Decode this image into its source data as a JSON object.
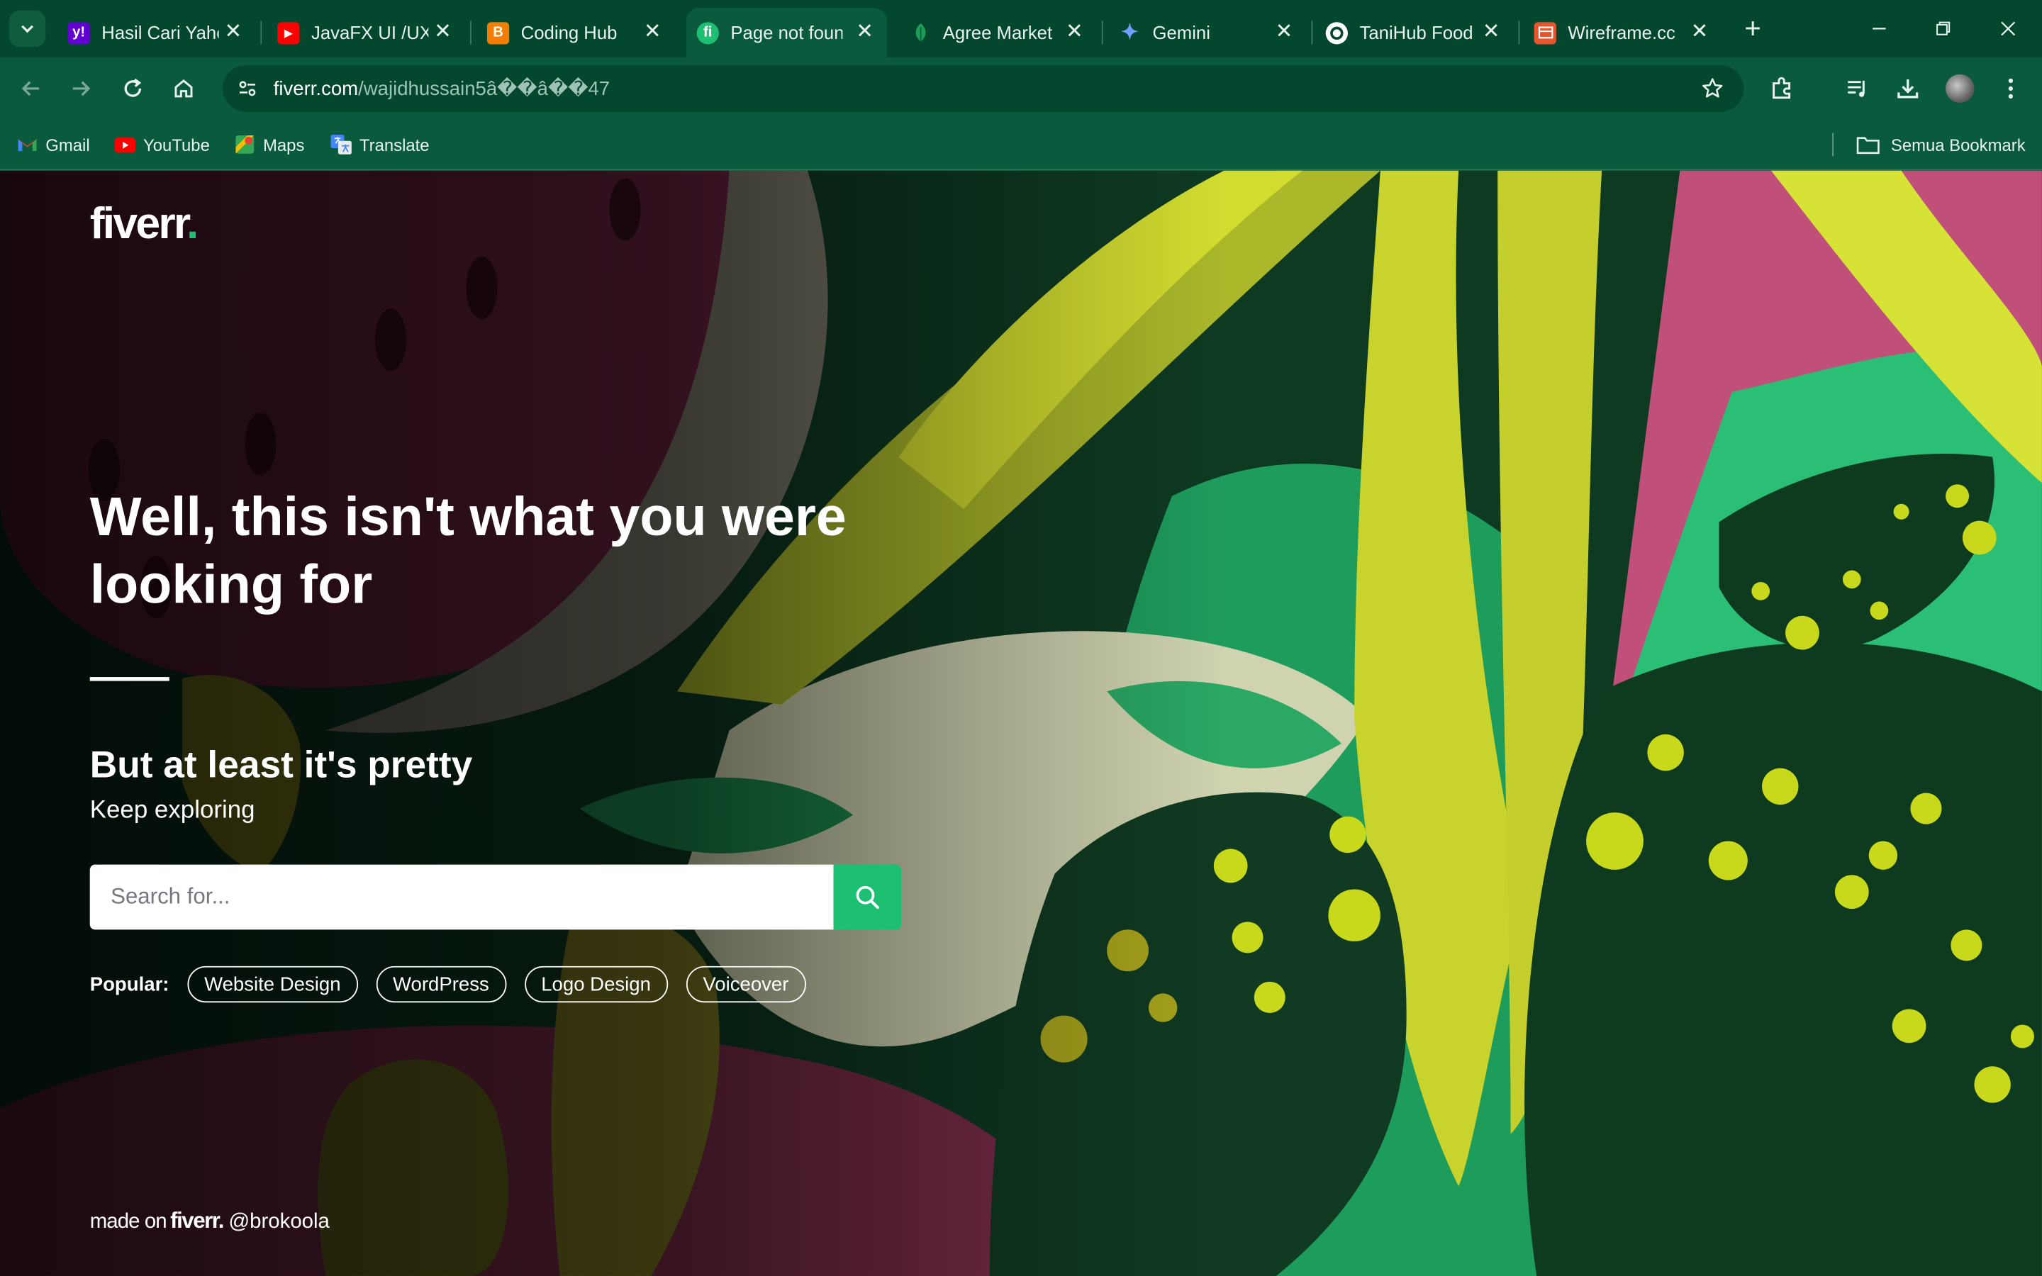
{
  "tabs": [
    {
      "title": "Hasil Cari Yahoo",
      "favicon": "yahoo-icon",
      "color": "#6001d2",
      "glyph": "y!"
    },
    {
      "title": "JavaFX UI /UX",
      "favicon": "youtube-icon",
      "color": "#ff0000",
      "glyph": "▶"
    },
    {
      "title": "Coding Hub",
      "favicon": "blogger-icon",
      "color": "#f57d00",
      "glyph": "B"
    },
    {
      "title": "Page not found",
      "favicon": "fiverr-icon",
      "color": "#1dbf73",
      "glyph": "fi",
      "active": true
    },
    {
      "title": "Agree Market",
      "favicon": "leaf-icon",
      "color": "#1e9e54",
      "glyph": ""
    },
    {
      "title": "Gemini",
      "favicon": "gemini-icon",
      "color": "#4e86f7",
      "glyph": "✦"
    },
    {
      "title": "TaniHub Food",
      "favicon": "tanihub-icon",
      "color": "#ffffff",
      "glyph": ""
    },
    {
      "title": "Wireframe.cc",
      "favicon": "wireframe-icon",
      "color": "#e8542c",
      "glyph": ""
    }
  ],
  "address_bar": {
    "domain": "fiverr.com",
    "path": "/wajidhussain5â��â��47"
  },
  "bookmarks": [
    {
      "label": "Gmail",
      "icon": "gmail-icon"
    },
    {
      "label": "YouTube",
      "icon": "youtube-icon"
    },
    {
      "label": "Maps",
      "icon": "maps-icon"
    },
    {
      "label": "Translate",
      "icon": "translate-icon"
    }
  ],
  "all_bookmarks_label": "Semua Bookmark",
  "page": {
    "logo": "fiverr",
    "headline": "Well, this isn't what you were looking for",
    "subheadline": "But at least it's pretty",
    "subtext": "Keep exploring",
    "search_placeholder": "Search for...",
    "popular_label": "Popular:",
    "popular_tags": [
      "Website Design",
      "WordPress",
      "Logo Design",
      "Voiceover"
    ],
    "made_on": "made on",
    "made_brand": "fiverr",
    "credit": "@brokoola"
  },
  "colors": {
    "brand_green": "#1dbf73",
    "chrome_dark": "#04472f",
    "chrome": "#0a5b3d"
  }
}
